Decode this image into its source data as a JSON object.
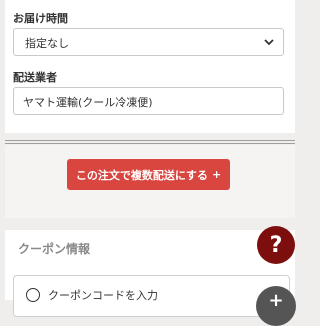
{
  "delivery": {
    "time_label": "お届け時間",
    "time_value": "指定なし",
    "carrier_label": "配送業者",
    "carrier_value": "ヤマト運輸(クール冷凍便)"
  },
  "multi_ship": {
    "button_label": "この注文で複数配送にする",
    "button_plus": "+"
  },
  "coupon": {
    "title": "クーポン情報",
    "option_label": "クーポンコードを入力"
  },
  "help": {
    "glyph": "?"
  },
  "fab": {
    "glyph": "+"
  },
  "colors": {
    "accent": "#d9453f",
    "help_bg": "#7d0e0e",
    "fab_bg": "#555555"
  }
}
